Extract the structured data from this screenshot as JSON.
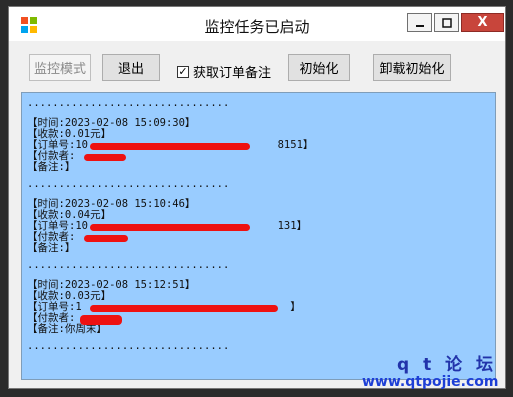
{
  "window": {
    "title": "监控任务已启动",
    "buttons": {
      "minimize": "—",
      "maximize": "□",
      "close": "X"
    }
  },
  "toolbar": {
    "monitor_mode": "监控模式",
    "exit": "退出",
    "get_order_note_label": "获取订单备注",
    "get_order_note_checked": true,
    "init": "初始化",
    "uninstall_init": "卸载初始化"
  },
  "log": {
    "separator": "................................",
    "entries": [
      {
        "time": "【时间:2023-02-08 15:09:30】",
        "amount": "【收款:0.01元】",
        "order": "【订单号:10                              8151】",
        "payer": "【付款者:",
        "note": "【备注:】"
      },
      {
        "time": "【时间:2023-02-08 15:10:46】",
        "amount": "【收款:0.04元】",
        "order": "【订单号:10                              131】",
        "payer": "【付款者:",
        "note": "【备注:】"
      },
      {
        "time": "【时间:2023-02-08 15:12:51】",
        "amount": "【收款:0.03元】",
        "order": "【订单号:1                                 】",
        "payer": "【付款者:",
        "note": "【备注:你周末】"
      }
    ]
  },
  "watermark": {
    "line1": "q t 论 坛",
    "line2": "www.qtpojie.com"
  }
}
